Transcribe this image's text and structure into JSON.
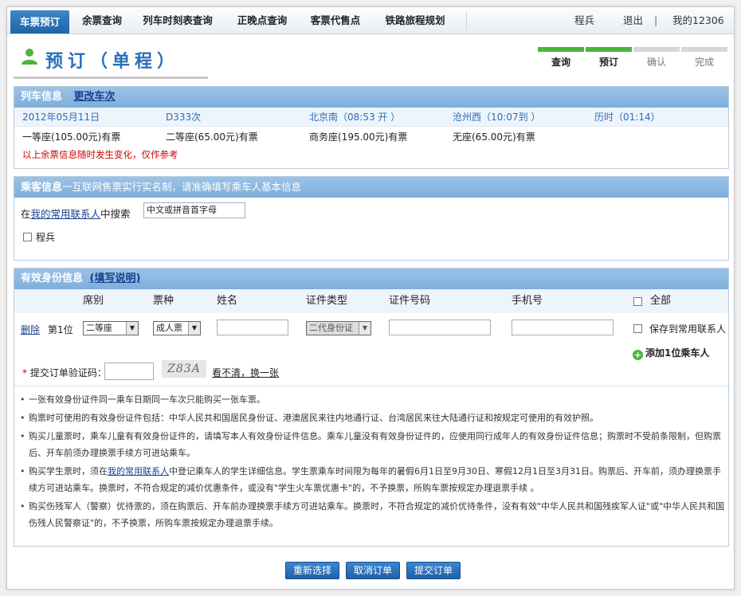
{
  "nav": {
    "items": [
      {
        "label": "车票预订",
        "active": true
      },
      {
        "label": "余票查询"
      },
      {
        "label": "列车时刻表查询"
      },
      {
        "label": "正晚点查询"
      },
      {
        "label": "客票代售点"
      },
      {
        "label": "铁路旅程规划"
      }
    ],
    "user_name": "程兵",
    "logout": "退出",
    "separator": "|",
    "my_account": "我的12306"
  },
  "header": {
    "title": "预订（单程）",
    "steps": [
      {
        "label": "查询",
        "done": true
      },
      {
        "label": "预订",
        "done": true
      },
      {
        "label": "确认",
        "done": false
      },
      {
        "label": "完成",
        "done": false
      }
    ]
  },
  "train_info": {
    "heading": "列车信息",
    "change_link": "更改车次",
    "date": "2012年05月11日",
    "train_no": "D333次",
    "depart": "北京南（08:53 开 ）",
    "arrive": "沧州西（10:07到 ）",
    "duration": "历时（01:14）",
    "seats": [
      "一等座(105.00元)有票",
      "二等座(65.00元)有票",
      "商务座(195.00元)有票",
      "无座(65.00元)有票"
    ],
    "notice": "以上余票信息随时发生变化，仅作参考"
  },
  "passenger_info": {
    "heading": "乘客信息",
    "subheading": "一互联网售票实行实名制，请准确填写乘车人基本信息",
    "search_prefix": "在",
    "search_link": "我的常用联系人",
    "search_suffix": "中搜索",
    "search_placeholder": "中文或拼音首字母",
    "contact_name": "程兵"
  },
  "id_info": {
    "heading": "有效身份信息",
    "help_link": "(填写说明)",
    "columns": [
      "席别",
      "票种",
      "姓名",
      "证件类型",
      "证件号码",
      "手机号"
    ],
    "select_all": "全部",
    "delete": "删除",
    "position": "第1位",
    "seat_type": "二等座",
    "ticket_type": "成人票",
    "id_type": "二代身份证",
    "save_contact": "保存到常用联系人",
    "add_passenger": "添加1位乘车人",
    "verify_label": "提交订单验证码：",
    "required_mark": "*",
    "captcha_text": "Z83A",
    "captcha_refresh": "看不清，换一张"
  },
  "notes": {
    "n1": "一张有效身份证件同一乘车日期同一车次只能购买一张车票。",
    "n2": "购票时可使用的有效身份证件包括：中华人民共和国居民身份证、港澳居民来往内地通行证、台湾居民来往大陆通行证和按规定可使用的有效护照。",
    "n3": "购买儿童票时，乘车儿童有有效身份证件的，请填写本人有效身份证件信息。乘车儿童没有有效身份证件的，应使用同行成年人的有效身份证件信息；购票时不受前条限制，但购票后、开车前须办理换票手续方可进站乘车。",
    "n4_pre": "购买学生票时，须在",
    "n4_link": "我的常用联系人",
    "n4_post": "中登记乘车人的学生详细信息。学生票乘车时间限为每年的暑假6月1日至9月30日、寒假12月1日至3月31日。购票后、开车前，须办理换票手续方可进站乘车。换票时，不符合规定的减价优惠条件，或没有\"学生火车票优惠卡\"的，不予换票，所购车票按规定办理退票手续 。",
    "n5": "购买伤残军人（警察）优待票的，须在购票后、开车前办理换票手续方可进站乘车。换票时，不符合规定的减价优待条件，没有有效\"中华人民共和国残疾军人证\"或\"中华人民共和国伤残人民警察证\"的，不予换票，所购车票按规定办理退票手续。"
  },
  "buttons": {
    "reselect": "重新选择",
    "cancel": "取消订单",
    "submit": "提交订单"
  }
}
